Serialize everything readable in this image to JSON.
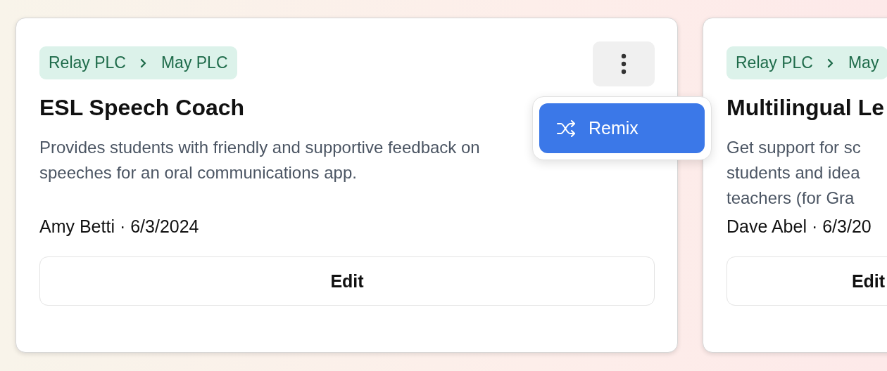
{
  "cards": [
    {
      "breadcrumb": [
        "Relay PLC",
        "May PLC"
      ],
      "title": "ESL Speech Coach",
      "description_lines": [
        "Provides students with friendly and supportive feedback on",
        "speeches for an oral communications app."
      ],
      "meta": "Amy Betti · 6/3/2024",
      "button": "Edit"
    },
    {
      "breadcrumb": [
        "Relay PLC",
        "May"
      ],
      "title": "Multilingual Le",
      "description_lines": [
        "Get support for sc",
        "students and idea",
        "teachers (for Gra"
      ],
      "meta": "Dave Abel · 6/3/20",
      "button": "Edit"
    }
  ],
  "menu": {
    "open": true,
    "items": [
      {
        "label": "Remix",
        "selected": true
      }
    ]
  }
}
